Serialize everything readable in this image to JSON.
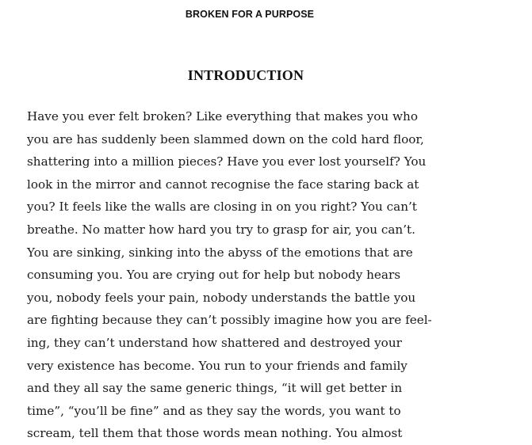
{
  "header": {
    "running_title": "BROKEN FOR A PURPOSE"
  },
  "chapter": {
    "title": "INTRODUCTION"
  },
  "body": {
    "lines": [
      "Have you ever felt broken? Like everything that makes you who",
      "you are has suddenly been slammed down on the cold hard floor,",
      "shattering into a million pieces? Have you ever lost yourself? You",
      "look in the mirror and cannot recognise the face staring back at",
      "you?  It feels like the walls are closing in on you right? You can’t",
      "breathe. No matter how hard you try to grasp for air, you can’t.",
      "You are sinking, sinking into the abyss of the emotions that are",
      "consuming you. You are crying out for help but nobody hears",
      "you, nobody feels your pain, nobody understands the battle you",
      "are fighting because they can’t possibly imagine how you are feel-",
      "ing, they can’t understand how shattered and destroyed your",
      "very existence has become. You run to your friends and family",
      "and they all say the same generic things, “it will get better in",
      "time”, “you’ll be fine” and as they say the words, you want to",
      "scream, tell them that those words mean nothing.  You almost"
    ]
  }
}
